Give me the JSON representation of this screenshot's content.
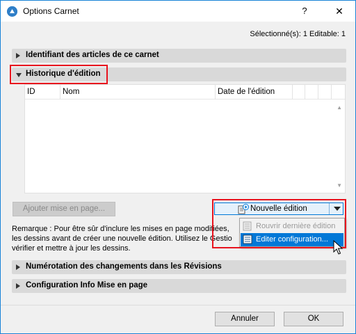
{
  "window": {
    "title": "Options Carnet",
    "help_label": "?",
    "close_label": "✕"
  },
  "selected_info": "Sélectionné(s): 1 Editable: 1",
  "sections": {
    "identifiant": "Identifiant des articles de ce carnet",
    "historique": "Historique d'édition",
    "numerotation": "Numérotation des changements dans les Révisions",
    "configuration": "Configuration Info Mise en page"
  },
  "table": {
    "columns": [
      "ID",
      "Nom",
      "Date de l'édition"
    ],
    "rows": []
  },
  "buttons": {
    "ajouter": "Ajouter mise en page...",
    "nouvelle_edition": "Nouvelle édition",
    "annuler": "Annuler",
    "ok": "OK"
  },
  "dropdown": {
    "items": [
      {
        "label": "Rouvrir dernière édition",
        "enabled": false
      },
      {
        "label": "Editer configuration...",
        "enabled": true,
        "selected": true
      }
    ]
  },
  "remark": {
    "line1": "Remarque : Pour être sûr d'inclure les mises en page modifiées,",
    "line2": "les dessins avant de créer une nouvelle édition. Utilisez le Gestio",
    "line3": "vérifier et mettre à jour les dessins."
  },
  "colors": {
    "accent": "#0078d7",
    "highlight": "#e8131e",
    "section_bg": "#d9d9d9"
  }
}
